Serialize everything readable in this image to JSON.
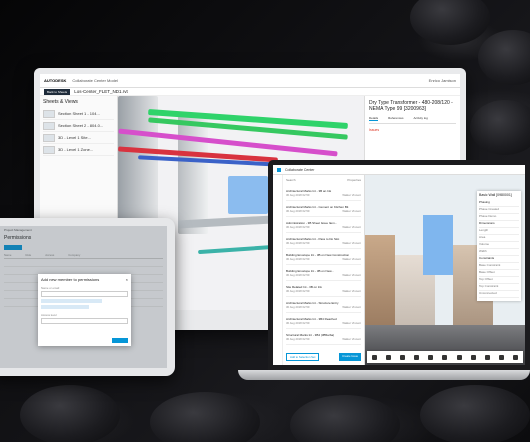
{
  "monitor": {
    "logo": "AUTODESK",
    "project": "Collaborate Center Model",
    "user": "Enrico Jamison",
    "back_label": "Back to Sheets",
    "file_title": "Los-Center_FLET_ND1.rvt",
    "sheets_title": "Sheets & Views",
    "sheets": [
      "Section Sheet 1 - 104...",
      "Section Sheet 2 - 804.0...",
      "3D - Level 1 Site...",
      "3D - Level 1 Zone..."
    ],
    "props_title": "Dry Type Transformer - 480-208/120 - NEMA Type 99 [3200963]",
    "props_tabs": [
      "Details",
      "References",
      "Activity log"
    ],
    "issue_label": "Issues"
  },
  "laptop": {
    "crumb": "Collaborate Center",
    "list_header_left": "Search",
    "list_header_right": "Properties",
    "items": [
      {
        "title": "Architectural Marks Int - 3B an Ink",
        "date": "30 Aug 2018 02:59",
        "owner": "Walker Vincent"
      },
      {
        "title": "Architectural Marks Int - Cement on Kitchen Bit",
        "date": "30 Aug 2018 02:59",
        "owner": "Walker Vincent"
      },
      {
        "title": "Administration - 3B Sheet Issue Item...",
        "date": "30 Aug 2018 02:59",
        "owner": "Walker Vincent"
      },
      {
        "title": "Architectural Marks Int - Pass to Do Slot",
        "date": "30 Aug 2018 02:59",
        "owner": "Walker Vincent"
      },
      {
        "title": "Building Envelope Int - 3B on New Construction",
        "date": "30 Aug 2018 02:59",
        "owner": "Walker Vincent"
      },
      {
        "title": "Building Envelope Int - 3B on New...",
        "date": "30 Aug 2018 02:59",
        "owner": "Walker Vincent"
      },
      {
        "title": "Site Related Int - 3B on Ink",
        "date": "30 Aug 2018 02:59",
        "owner": "Walker Vincent"
      },
      {
        "title": "Architectural Marks Int - Structure Entry",
        "date": "30 Aug 2018 02:59",
        "owner": "Walker Vincent"
      },
      {
        "title": "Architectural Marks Int - 3B4 Reached",
        "date": "30 Aug 2018 02:59",
        "owner": "Walker Vincent"
      },
      {
        "title": "Structural Marks Int - 3B4 (3B5arba)",
        "date": "30 Aug 2018 02:59",
        "owner": "Walker Vincent"
      }
    ],
    "btn_left": "Add to Selection Set",
    "btn_right": "Create Issue",
    "panel_title": "Basic Wall [0980001]",
    "panel_section1": "Phasing",
    "panel_rows1": [
      "Phase Created",
      "Phase Demo"
    ],
    "panel_section2": "Dimensions",
    "panel_rows2": [
      "Length",
      "Area",
      "Volume",
      "Width"
    ],
    "panel_section3": "Constraints",
    "panel_rows3": [
      "Base Constraint",
      "Base Offset",
      "Top Offset",
      "Top Constraint",
      "Unconnected"
    ]
  },
  "tablet": {
    "crumb": "Project Management",
    "title": "Permissions",
    "headers": [
      "Name",
      "Role",
      "Access",
      "Company"
    ],
    "modal_title": "Add new member to permissions",
    "modal_label": "Name or email",
    "modal_label2": "Access level"
  },
  "colors": {
    "accent": "#0696d7",
    "pipe_green": "#2fd36a",
    "pipe_magenta": "#d64fcb",
    "pipe_red": "#d8333f",
    "pipe_blue": "#3b62c8",
    "glass_blue": "#7fb6ee"
  }
}
